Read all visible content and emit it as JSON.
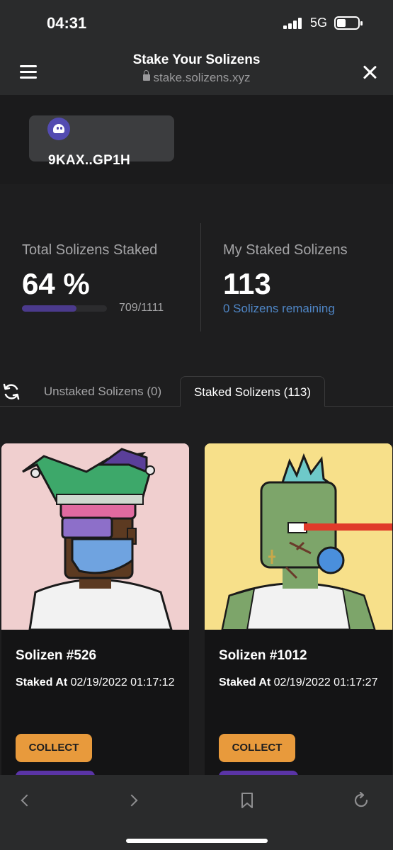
{
  "status_bar": {
    "time": "04:31",
    "network": "5G"
  },
  "nav": {
    "title": "Stake Your Solizens",
    "url": "stake.solizens.xyz"
  },
  "wallet": {
    "address": "9KAX..GP1H"
  },
  "stats": {
    "total_label": "Total Solizens Staked",
    "total_value": "64 %",
    "progress_fraction": 0.64,
    "progress_text": "709/1111",
    "mine_label": "My Staked Solizens",
    "mine_value": "113",
    "remaining_text": "0 Solizens remaining"
  },
  "tabs": [
    {
      "label": "Unstaked Solizens (0)",
      "active": false
    },
    {
      "label": "Staked Solizens (113)",
      "active": true
    }
  ],
  "cards": [
    {
      "name": "Solizen #526",
      "staked_label": "Staked At",
      "staked_value": "02/19/2022 01:17:12",
      "collect_label": "COLLECT"
    },
    {
      "name": "Solizen #1012",
      "staked_label": "Staked At",
      "staked_value": "02/19/2022 01:17:27",
      "collect_label": "COLLECT"
    }
  ],
  "colors": {
    "accent_purple": "#5a34a6",
    "collect_orange": "#e89a3c",
    "remaining_blue": "#4f86c6",
    "card1_bg": "#f0cfcf",
    "card2_bg": "#f7e08a"
  },
  "icons": [
    "menu-icon",
    "lock-icon",
    "close-icon",
    "phantom-icon",
    "refresh-icon",
    "back-icon",
    "forward-icon",
    "bookmark-icon",
    "reload-icon"
  ]
}
